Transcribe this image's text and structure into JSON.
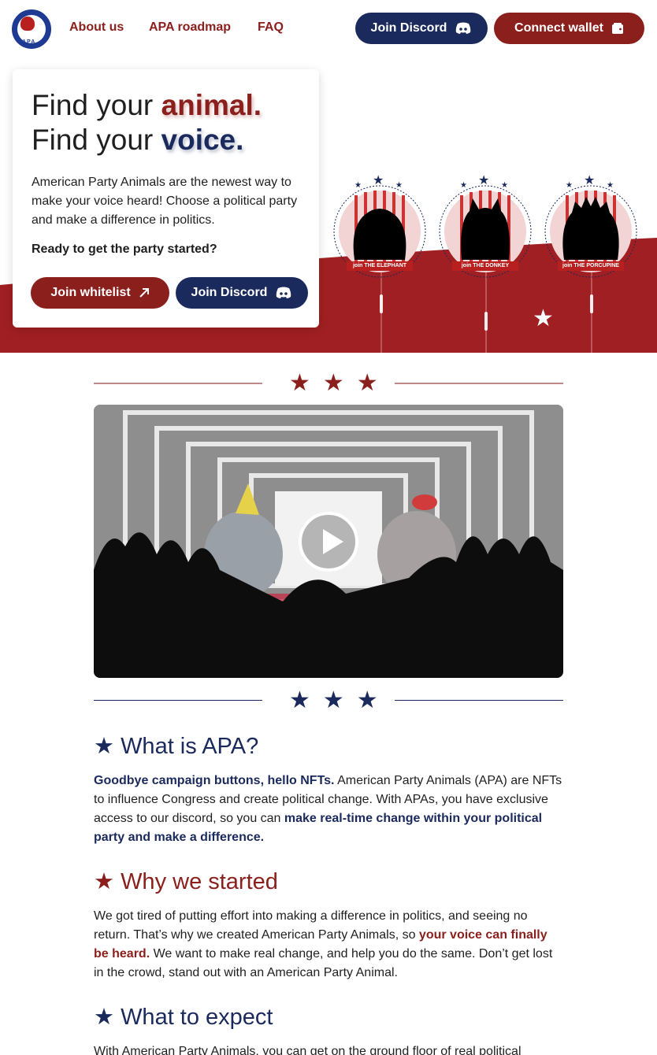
{
  "nav": {
    "logo_text": "APA",
    "links": [
      "About us",
      "APA roadmap",
      "FAQ"
    ],
    "join_discord": "Join Discord",
    "connect_wallet": "Connect wallet"
  },
  "hero": {
    "headline_prefix_1": "Find your ",
    "headline_word_1": "animal.",
    "headline_prefix_2": "Find your ",
    "headline_word_2": "voice.",
    "description": "American Party Animals are the newest way to make your voice heard! Choose a political party and make a difference in politics.",
    "cta_question": "Ready to get the party started?",
    "join_whitelist": "Join whitelist",
    "join_discord": "Join Discord",
    "badges": [
      {
        "label": "join THE ELEPHANT",
        "icon": "elephant-silhouette"
      },
      {
        "label": "join THE DONKEY",
        "icon": "donkey-silhouette"
      },
      {
        "label": "join THE PORCUPINE",
        "icon": "porcupine-silhouette"
      }
    ]
  },
  "divider": {
    "stars": "★★★"
  },
  "video": {
    "play_icon": "play-icon"
  },
  "sections": [
    {
      "star": "★",
      "title": "What is APA?",
      "parts": [
        {
          "text": "Goodbye campaign buttons, hello NFTs.",
          "style": "navy"
        },
        {
          "text": " American Party Animals (APA) are NFTs to influence Congress and create political change. With APAs, you have exclusive access to our discord, so you can ",
          "style": "plain"
        },
        {
          "text": "make real-time change within your political party and make a difference.",
          "style": "navy"
        }
      ]
    },
    {
      "star": "★",
      "title": "Why we started",
      "parts": [
        {
          "text": "We got tired of putting effort into making a difference in politics, and seeing no return. That’s why we created American Party Animals, so ",
          "style": "plain"
        },
        {
          "text": "your voice can finally be heard.",
          "style": "red"
        },
        {
          "text": " We want to make real change, and help you do the same. Don’t get lost in the crowd, stand out with an American Party Animal.",
          "style": "plain"
        }
      ]
    },
    {
      "star": "★",
      "title": "What to expect",
      "parts": [
        {
          "text": "With American Party Animals, you can get on the ground floor of real political",
          "style": "plain"
        }
      ]
    }
  ],
  "colors": {
    "navy": "#1b2a5c",
    "red": "#8a1f1c",
    "hero_red": "#a01f22"
  }
}
